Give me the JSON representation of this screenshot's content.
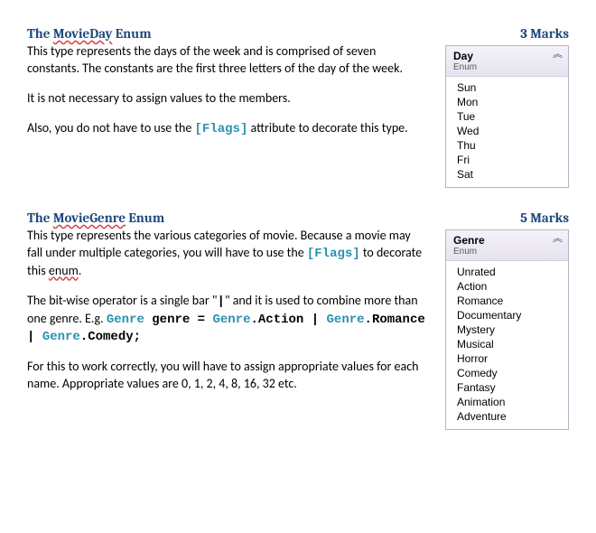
{
  "sections": [
    {
      "heading_prefix": "The ",
      "heading_kw": "MovieDay",
      "heading_suffix": " Enum",
      "marks": "3 Marks",
      "paragraphs": [
        "This type represents the days of the week and is comprised of seven constants. The constants are the first three letters of the day of the week.",
        "It is not necessary to assign values to the members.",
        "Also, you do not have to use the [Flags] attribute to decorate this type."
      ],
      "enum_title": "Day",
      "enum_type": "Enum",
      "enum_items": [
        "Sun",
        "Mon",
        "Tue",
        "Wed",
        "Thu",
        "Fri",
        "Sat"
      ]
    },
    {
      "heading_prefix": "The ",
      "heading_kw": "MovieGenre",
      "heading_suffix": " Enum",
      "marks": "5 Marks",
      "paragraphs": [
        "This type represents the various categories of movie. Because a movie may fall under multiple categories, you will have to use the [Flags] to decorate this enum.",
        "The bit-wise operator is a single bar \"|\" and it is used to combine more than one genre. E.g. Genre genre = Genre.Action | Genre.Romance | Genre.Comedy;",
        "For this to work correctly, you will have to assign appropriate values for each name. Appropriate values are 0, 1, 2, 4, 8, 16, 32 etc."
      ],
      "enum_title": "Genre",
      "enum_type": "Enum",
      "enum_items": [
        "Unrated",
        "Action",
        "Romance",
        "Documentary",
        "Mystery",
        "Musical",
        "Horror",
        "Comedy",
        "Fantasy",
        "Animation",
        "Adventure"
      ]
    }
  ],
  "code_tokens": {
    "flags": "[Flags]",
    "genre": "Genre",
    "decl": " genre = ",
    "dot_action": ".Action ",
    "bar": "| ",
    "dot_romance": ".Romance ",
    "dot_comedy": ".Comedy;"
  }
}
